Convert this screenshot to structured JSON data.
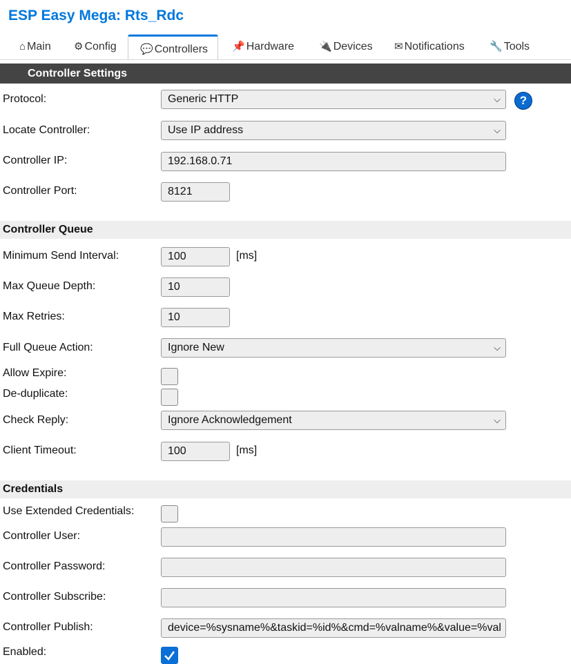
{
  "title": "ESP Easy Mega: Rts_Rdc",
  "tabs": [
    {
      "icon": "⌂",
      "label": "Main"
    },
    {
      "icon": "⚙",
      "label": "Config"
    },
    {
      "icon": "💬",
      "label": "Controllers"
    },
    {
      "icon": "📌",
      "label": "Hardware"
    },
    {
      "icon": "🔌",
      "label": "Devices"
    },
    {
      "icon": "✉",
      "label": "Notifications"
    },
    {
      "icon": "🔧",
      "label": "Tools"
    }
  ],
  "active_tab": "Controllers",
  "header": "Controller Settings",
  "help_icon": "?",
  "fields": {
    "protocol": {
      "label": "Protocol:",
      "value": "Generic HTTP"
    },
    "locate": {
      "label": "Locate Controller:",
      "value": "Use IP address"
    },
    "ip": {
      "label": "Controller IP:",
      "value": "192.168.0.71"
    },
    "port": {
      "label": "Controller Port:",
      "value": "8121"
    }
  },
  "queue": {
    "section": "Controller Queue",
    "min_send": {
      "label": "Minimum Send Interval:",
      "value": "100",
      "unit": "[ms]"
    },
    "max_depth": {
      "label": "Max Queue Depth:",
      "value": "10"
    },
    "max_retries": {
      "label": "Max Retries:",
      "value": "10"
    },
    "full_action": {
      "label": "Full Queue Action:",
      "value": "Ignore New"
    },
    "allow_expire": {
      "label": "Allow Expire:",
      "checked": false
    },
    "dedup": {
      "label": "De-duplicate:",
      "checked": false
    },
    "check_reply": {
      "label": "Check Reply:",
      "value": "Ignore Acknowledgement"
    },
    "client_timeout": {
      "label": "Client Timeout:",
      "value": "100",
      "unit": "[ms]"
    }
  },
  "credentials": {
    "section": "Credentials",
    "extended": {
      "label": "Use Extended Credentials:",
      "checked": false
    },
    "user": {
      "label": "Controller User:",
      "value": ""
    },
    "password": {
      "label": "Controller Password:",
      "value": ""
    },
    "subscribe": {
      "label": "Controller Subscribe:",
      "value": ""
    },
    "publish": {
      "label": "Controller Publish:",
      "value": "device=%sysname%&taskid=%id%&cmd=%valname%&value=%val"
    },
    "enabled": {
      "label": "Enabled:",
      "checked": true
    }
  },
  "colors": {
    "accent": "#0077dd",
    "header_bg": "#444444",
    "section_bg": "#eeeeee"
  }
}
